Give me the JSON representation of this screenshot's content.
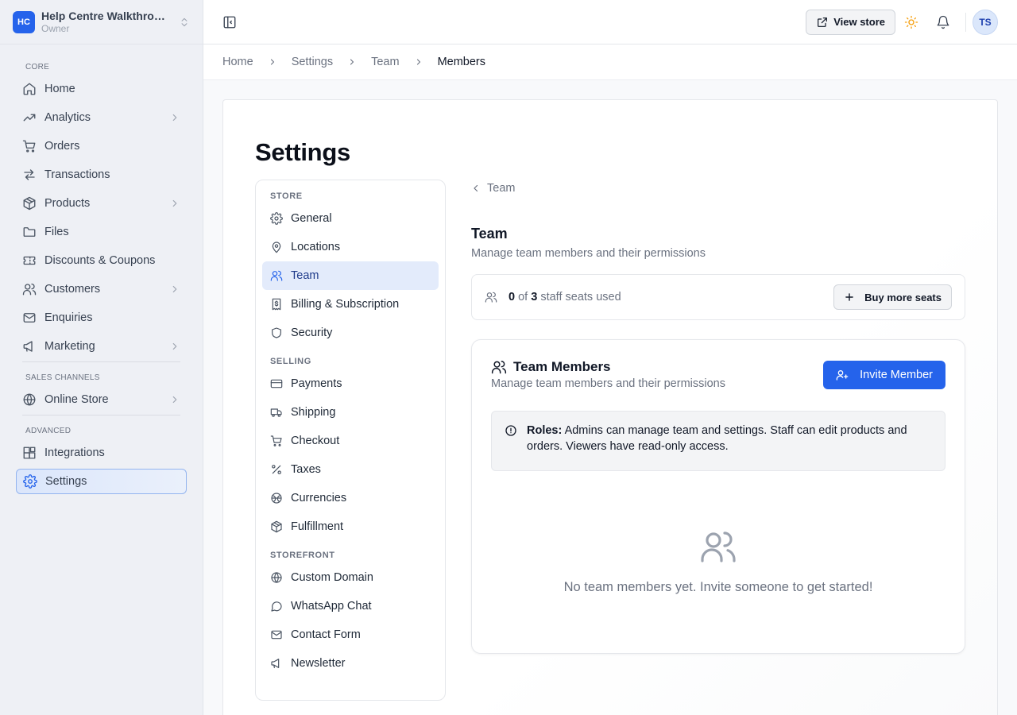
{
  "brand": {
    "initials": "HC",
    "name": "Help Centre Walkthrough",
    "role": "Owner"
  },
  "sidebar": {
    "sections": [
      {
        "label": "CORE",
        "items": [
          {
            "label": "Home",
            "icon": "home-icon",
            "chevron": false
          },
          {
            "label": "Analytics",
            "icon": "trend-icon",
            "chevron": true
          },
          {
            "label": "Orders",
            "icon": "cart-icon",
            "chevron": false
          },
          {
            "label": "Transactions",
            "icon": "arrows-icon",
            "chevron": false
          },
          {
            "label": "Products",
            "icon": "package-icon",
            "chevron": true
          },
          {
            "label": "Files",
            "icon": "folder-icon",
            "chevron": false
          },
          {
            "label": "Discounts & Coupons",
            "icon": "ticket-icon",
            "chevron": false
          },
          {
            "label": "Customers",
            "icon": "users-icon",
            "chevron": true
          },
          {
            "label": "Enquiries",
            "icon": "mail-icon",
            "chevron": false
          },
          {
            "label": "Marketing",
            "icon": "megaphone-icon",
            "chevron": true
          }
        ]
      },
      {
        "label": "SALES CHANNELS",
        "items": [
          {
            "label": "Online Store",
            "icon": "globe-icon",
            "chevron": true
          }
        ]
      },
      {
        "label": "ADVANCED",
        "items": [
          {
            "label": "Integrations",
            "icon": "blocks-icon",
            "chevron": false
          },
          {
            "label": "Settings",
            "icon": "gear-icon",
            "chevron": false,
            "active": true
          }
        ]
      }
    ]
  },
  "topbar": {
    "view_store": "View store",
    "avatar": "TS"
  },
  "breadcrumb": [
    "Home",
    "Settings",
    "Team",
    "Members"
  ],
  "page": {
    "title": "Settings"
  },
  "settings_nav": [
    {
      "label": "STORE",
      "items": [
        {
          "label": "General",
          "icon": "gear-icon"
        },
        {
          "label": "Locations",
          "icon": "pin-icon"
        },
        {
          "label": "Team",
          "icon": "users-icon",
          "active": true
        },
        {
          "label": "Billing & Subscription",
          "icon": "receipt-icon"
        },
        {
          "label": "Security",
          "icon": "shield-icon"
        }
      ]
    },
    {
      "label": "SELLING",
      "items": [
        {
          "label": "Payments",
          "icon": "card-icon"
        },
        {
          "label": "Shipping",
          "icon": "truck-icon"
        },
        {
          "label": "Checkout",
          "icon": "cart-icon"
        },
        {
          "label": "Taxes",
          "icon": "percent-icon"
        },
        {
          "label": "Currencies",
          "icon": "coins-icon"
        },
        {
          "label": "Fulfillment",
          "icon": "package-icon"
        }
      ]
    },
    {
      "label": "STOREFRONT",
      "items": [
        {
          "label": "Custom Domain",
          "icon": "globe-icon"
        },
        {
          "label": "WhatsApp Chat",
          "icon": "chat-icon"
        },
        {
          "label": "Contact Form",
          "icon": "mail-icon"
        },
        {
          "label": "Newsletter",
          "icon": "megaphone-icon"
        }
      ]
    }
  ],
  "panel": {
    "back": "Team",
    "title": "Team",
    "subtitle": "Manage team members and their permissions",
    "seats": {
      "used": "0",
      "of_word": "of",
      "total": "3",
      "suffix": "staff seats used",
      "buy_label": "Buy more seats"
    },
    "members": {
      "title": "Team Members",
      "subtitle": "Manage team members and their permissions",
      "invite_label": "Invite Member",
      "notice_bold": "Roles:",
      "notice_text": "Admins can manage team and settings. Staff can edit products and orders. Viewers have read-only access.",
      "empty_text": "No team members yet. Invite someone to get started!"
    }
  }
}
